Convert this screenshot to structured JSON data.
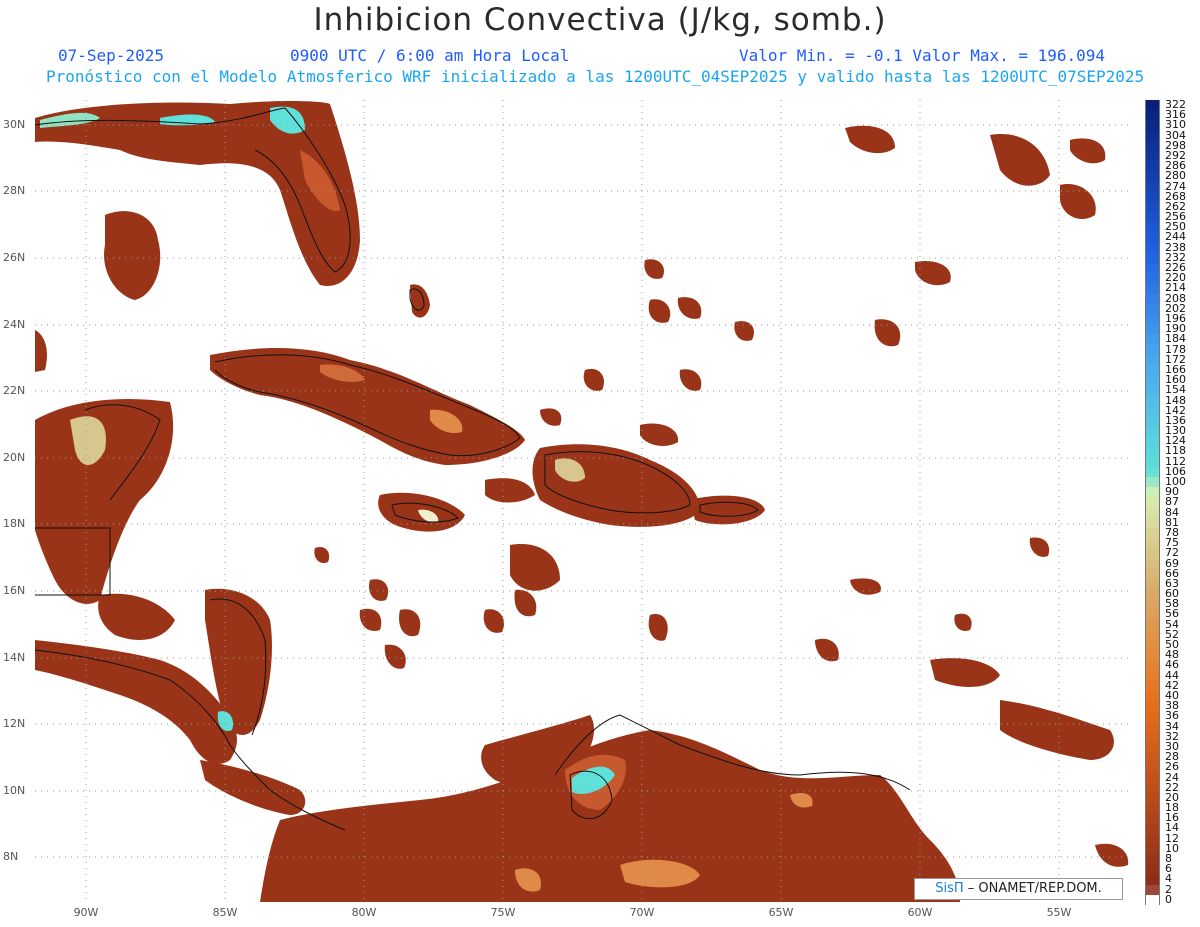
{
  "header": {
    "title": "Inhibicion Convectiva (J/kg, somb.)",
    "date": "07-Sep-2025",
    "time": "0900 UTC / 6:00 am Hora Local",
    "minmax": "Valor Min. = -0.1  Valor Max. = 196.094",
    "model_line": "Pronóstico con el Modelo Atmosferico WRF inicializado a las 1200UTC_04SEP2025 y valido hasta las  1200UTC_07SEP2025"
  },
  "axes": {
    "lat_labels": [
      "30N",
      "28N",
      "26N",
      "24N",
      "22N",
      "20N",
      "18N",
      "16N",
      "14N",
      "12N",
      "10N",
      "8N"
    ],
    "lon_labels": [
      "90W",
      "85W",
      "80W",
      "75W",
      "70W",
      "65W",
      "60W",
      "55W"
    ]
  },
  "legend": {
    "labels": [
      "322",
      "316",
      "310",
      "304",
      "298",
      "292",
      "286",
      "280",
      "274",
      "268",
      "262",
      "256",
      "250",
      "244",
      "238",
      "232",
      "226",
      "220",
      "214",
      "208",
      "202",
      "196",
      "190",
      "184",
      "178",
      "172",
      "166",
      "160",
      "154",
      "148",
      "142",
      "136",
      "130",
      "124",
      "118",
      "112",
      "106",
      "100",
      "90",
      "87",
      "84",
      "81",
      "78",
      "75",
      "72",
      "69",
      "66",
      "63",
      "60",
      "58",
      "56",
      "54",
      "52",
      "50",
      "48",
      "46",
      "44",
      "42",
      "40",
      "38",
      "36",
      "34",
      "32",
      "30",
      "28",
      "26",
      "24",
      "22",
      "20",
      "18",
      "16",
      "14",
      "12",
      "10",
      "8",
      "6",
      "4",
      "2",
      "0"
    ],
    "palette": {
      "deep_blue": "#08207a",
      "blue": "#1f5fe0",
      "light_blue": "#4aa8ee",
      "cyan": "#5fe0d8",
      "pale_green": "#d8efb0",
      "tan": "#d8b070",
      "orange": "#e8701a",
      "dark_red": "#8a2a1a",
      "zero": "#ffffff"
    }
  },
  "credit": {
    "brand": "SisΠ",
    "text": "– ONAMET/REP.DOM."
  }
}
